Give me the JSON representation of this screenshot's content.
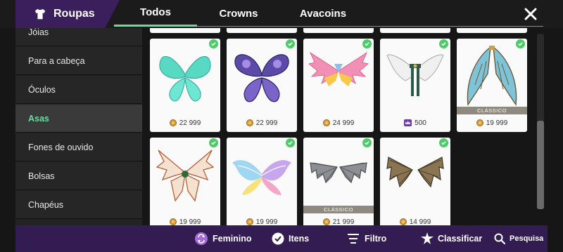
{
  "header": {
    "title": "Roupas",
    "tabs": [
      {
        "label": "Todos",
        "active": true
      },
      {
        "label": "Crowns",
        "active": false
      },
      {
        "label": "Avacoins",
        "active": false
      }
    ],
    "accent_color": "#5fe0a0",
    "brand_color": "#3a1f5c"
  },
  "sidebar": {
    "items": [
      {
        "label": "Jóias",
        "active": false
      },
      {
        "label": "Para a cabeça",
        "active": false
      },
      {
        "label": "Óculos",
        "active": false
      },
      {
        "label": "Asas",
        "active": true
      },
      {
        "label": "Fones de ouvido",
        "active": false
      },
      {
        "label": "Bolsas",
        "active": false
      },
      {
        "label": "Chapéus",
        "active": false
      }
    ]
  },
  "items": [
    {
      "name": "teal-leaf-wings",
      "price": "22 999",
      "currency": "avacoin-icon",
      "owned": true,
      "tag": ""
    },
    {
      "name": "purple-butterfly-wings",
      "price": "22 999",
      "currency": "avacoin-icon",
      "owned": true,
      "tag": ""
    },
    {
      "name": "sunset-feather-wings",
      "price": "24 999",
      "currency": "avacoin-icon",
      "owned": true,
      "tag": ""
    },
    {
      "name": "white-angel-wings",
      "price": "500",
      "currency": "crown-icon",
      "owned": true,
      "tag": ""
    },
    {
      "name": "stained-glass-wings",
      "price": "19 999",
      "currency": "avacoin-icon",
      "owned": true,
      "tag": "CLÁSSICO"
    },
    {
      "name": "autumn-fairy-wings",
      "price": "19 999",
      "currency": "avacoin-icon",
      "owned": true,
      "tag": ""
    },
    {
      "name": "rainbow-feather-wings",
      "price": "19 999",
      "currency": "avacoin-icon",
      "owned": true,
      "tag": ""
    },
    {
      "name": "grey-dragon-wings",
      "price": "21 999",
      "currency": "avacoin-icon",
      "owned": true,
      "tag": "CLÁSSICO"
    },
    {
      "name": "brown-bat-wings",
      "price": "14 999",
      "currency": "avacoin-icon",
      "owned": true,
      "tag": ""
    }
  ],
  "bottom_bar": {
    "feminino": "Feminino",
    "itens": "Itens",
    "filtro": "Filtro",
    "classificar": "Classificar",
    "pesquisa": "Pesquisa"
  },
  "colors": {
    "owned_check": "#4ccb66",
    "classic_ribbon": "#8f8a7f",
    "bottom_bar": "#321c52"
  }
}
